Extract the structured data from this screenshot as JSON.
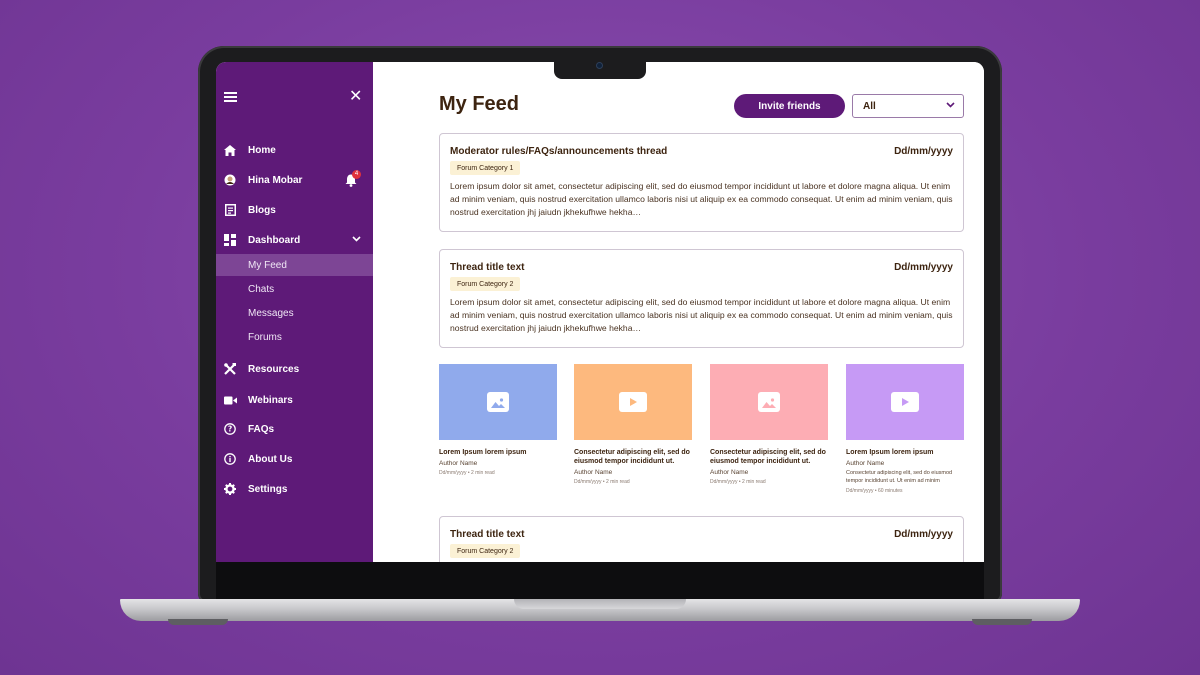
{
  "sidebar": {
    "menu_icon": "hamburger-icon",
    "close_icon": "close-icon",
    "items": [
      {
        "label": "Home",
        "icon": "home-icon"
      },
      {
        "label": "Hina Mobar",
        "icon": "avatar-icon"
      },
      {
        "label": "Blogs",
        "icon": "blog-icon"
      },
      {
        "label": "Dashboard",
        "icon": "dashboard-icon"
      },
      {
        "label": "Resources",
        "icon": "tools-icon"
      },
      {
        "label": "Webinars",
        "icon": "video-icon"
      },
      {
        "label": "FAQs",
        "icon": "help-icon"
      },
      {
        "label": "About Us",
        "icon": "info-icon"
      },
      {
        "label": "Settings",
        "icon": "gear-icon"
      }
    ],
    "subitems": [
      "My Feed",
      "Chats",
      "Messages",
      "Forums"
    ],
    "notification_count": "4"
  },
  "main": {
    "title": "My Feed",
    "invite_label": "Invite friends",
    "filter_value": "All",
    "posts": [
      {
        "title": "Moderator rules/FAQs/announcements thread",
        "date": "Dd/mm/yyyy",
        "category": "Forum Category 1",
        "body": "Lorem ipsum dolor sit amet, consectetur adipiscing elit, sed do eiusmod tempor incididunt ut labore et dolore magna aliqua. Ut enim ad minim veniam, quis nostrud exercitation ullamco laboris nisi ut aliquip ex ea commodo consequat. Ut enim ad minim veniam, quis nostrud exercitation jhj jaiudn jkhekufhwe hekha…"
      },
      {
        "title": "Thread title text",
        "date": "Dd/mm/yyyy",
        "category": "Forum Category 2",
        "body": "Lorem ipsum dolor sit amet, consectetur adipiscing elit, sed do eiusmod tempor incididunt ut labore et dolore magna aliqua. Ut enim ad minim veniam, quis nostrud exercitation ullamco laboris nisi ut aliquip ex ea commodo consequat. Ut enim ad minim veniam, quis nostrud exercitation jhj jaiudn jkhekufhwe hekha…"
      },
      {
        "title": "Thread title text",
        "date": "Dd/mm/yyyy",
        "category": "Forum Category 2"
      }
    ],
    "tiles": [
      {
        "title": "Lorem Ipsum lorem ipsum",
        "author": "Author Name",
        "meta": "Dd/mm/yyyy  •  2 min read",
        "color": "#90aaec",
        "icon": "image-icon"
      },
      {
        "title": "Consectetur adipiscing elit, sed do eiusmod tempor incididunt ut.",
        "author": "Author Name",
        "meta": "Dd/mm/yyyy  •  2 min read",
        "color": "#fdb97e",
        "icon": "play-icon"
      },
      {
        "title": "Consectetur adipiscing elit, sed do eiusmod tempor incididunt ut.",
        "author": "Author Name",
        "meta": "Dd/mm/yyyy  •  2 min read",
        "color": "#fdadb4",
        "icon": "image-icon"
      },
      {
        "title": "Lorem Ipsum lorem ipsum",
        "author": "Author Name",
        "desc": "Consectetur adipiscing elit, sed do eiusmod tempor incididunt ut. Ut enim ad minim",
        "meta": "Dd/mm/yyyy  •  60 minutes",
        "color": "#c69af5",
        "icon": "play-icon"
      }
    ]
  },
  "colors": {
    "brand": "#5e1a78",
    "sidebar_active": "#7d4595",
    "text_brown": "#3d2410",
    "chip_bg": "#fbf1d5"
  }
}
